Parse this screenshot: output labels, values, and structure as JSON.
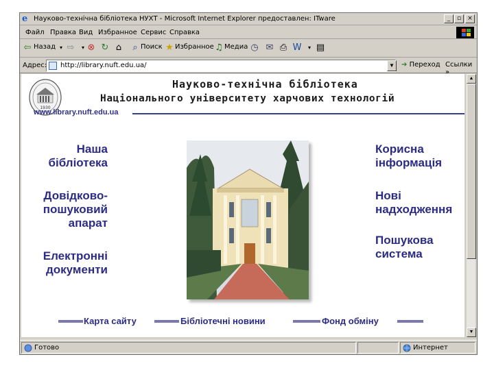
{
  "window": {
    "title": "Науково-технічна бібліотека НУХТ - Microsoft Internet Explorer предоставлен: ITware",
    "min_glyph": "_",
    "max_glyph": "▫",
    "close_glyph": "×"
  },
  "menu": {
    "items": [
      "Файл",
      "Правка",
      "Вид",
      "Избранное",
      "Сервис",
      "Справка"
    ]
  },
  "toolbar": {
    "back_label": "Назад",
    "search_label": "Поиск",
    "favorites_label": "Избранное",
    "media_label": "Медиа"
  },
  "address": {
    "label": "Адрес:",
    "url": "http://library.nuft.edu.ua/",
    "go_label": "Переход",
    "links_label": "Ссылки"
  },
  "page": {
    "heading_line1": "Науково-технічна бібліотека",
    "heading_line2": "Національного університету харчових технологій",
    "site_url": "www.library.nuft.edu.ua",
    "logo_year": "1930",
    "left_nav": [
      "Наша\nбібліотека",
      "Довідково-\nпошуковий\nапарат",
      "Електронні\nдокументи"
    ],
    "right_nav": [
      "Корисна\nінформація",
      "Нові\nнадходження",
      "Пошукова\nсистема"
    ],
    "bottom_nav": [
      "Карта сайту",
      "Бібліотечні новини",
      "Фонд обміну"
    ]
  },
  "status": {
    "left_text": "Готово",
    "zone_text": "Интернет"
  },
  "colors": {
    "link": "#2b2b86",
    "bar": "#7a78ad",
    "chrome": "#d4d0c8"
  }
}
